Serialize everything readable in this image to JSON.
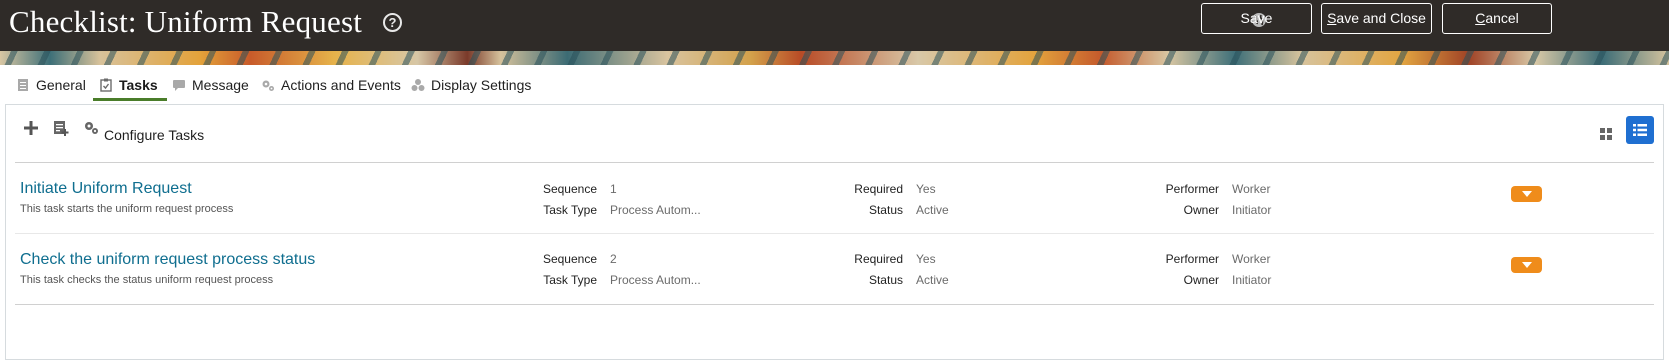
{
  "header": {
    "title": "Checklist: Uniform Request",
    "help_icon": "question-circle-icon",
    "globe_icon": "globe-icon",
    "save_label": "Save",
    "save_close_first": "S",
    "save_close_rest": "ave and Close",
    "cancel_first": "C",
    "cancel_rest": "ancel"
  },
  "tabs": [
    {
      "label": "General",
      "icon": "document-icon"
    },
    {
      "label": "Tasks",
      "icon": "clipboard-check-icon",
      "active": true
    },
    {
      "label": "Message",
      "icon": "message-icon"
    },
    {
      "label": "Actions and Events",
      "icon": "gears-icon"
    },
    {
      "label": "Display Settings",
      "icon": "shapes-icon"
    }
  ],
  "toolbar": {
    "add_icon": "plus-icon",
    "add_from_library_icon": "add-list-icon",
    "configure_label": "Configure Tasks",
    "configure_icon": "gears-icon",
    "grid_view_icon": "grid-view-icon",
    "list_view_icon": "list-view-icon"
  },
  "field_labels": {
    "sequence": "Sequence",
    "task_type": "Task Type",
    "required": "Required",
    "status": "Status",
    "performer": "Performer",
    "owner": "Owner"
  },
  "tasks": [
    {
      "title": "Initiate Uniform Request",
      "description": "This task starts the uniform request process",
      "sequence": "1",
      "task_type": "Process Autom...",
      "required": "Yes",
      "status": "Active",
      "performer": "Worker",
      "owner": "Initiator"
    },
    {
      "title": "Check the uniform request process status",
      "description": "This task checks the status uniform request process",
      "sequence": "2",
      "task_type": "Process Autom...",
      "required": "Yes",
      "status": "Active",
      "performer": "Worker",
      "owner": "Initiator"
    }
  ],
  "colors": {
    "header_bg": "#2f2b28",
    "link": "#0f6e8f",
    "accent_orange": "#ef8c1b",
    "active_view": "#1f6fd1",
    "tab_underline": "#4a7d2a"
  }
}
